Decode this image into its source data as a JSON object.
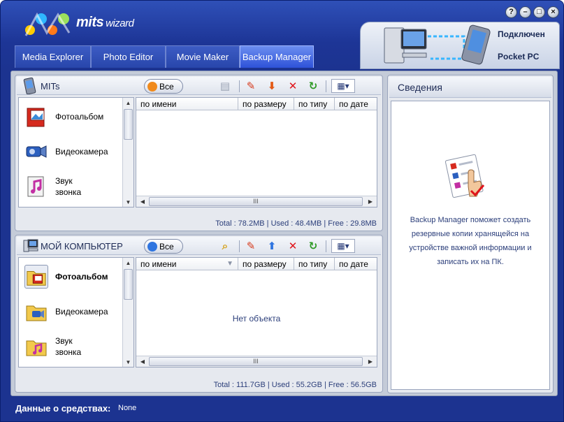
{
  "app": {
    "logo": {
      "brand": "mits",
      "product": "wizard"
    },
    "window_buttons": [
      "?",
      "–",
      "□",
      "×"
    ]
  },
  "tabs": [
    {
      "label": "Media Explorer",
      "active": false
    },
    {
      "label": "Photo Editor",
      "active": false
    },
    {
      "label": "Movie Maker",
      "active": false
    },
    {
      "label": "Backup Manager",
      "active": true
    }
  ],
  "device": {
    "status": "Подключен",
    "name": "Pocket PC"
  },
  "mits_panel": {
    "title": "MITs",
    "all_button": "Все",
    "categories": [
      {
        "label_line1": "Фотоальбом",
        "label_line2": "",
        "icon": "photo-album-icon",
        "selected": false
      },
      {
        "label_line1": "Видеокамера",
        "label_line2": "",
        "icon": "video-camera-icon",
        "selected": false
      },
      {
        "label_line1": "Звук",
        "label_line2": "звонка",
        "icon": "ringtone-icon",
        "selected": false
      }
    ],
    "columns": [
      "по имени",
      "по размеру",
      "по типу",
      "по дате"
    ],
    "empty_message": "",
    "stats": "Total : 78.2MB  |  Used : 48.4MB  |  Free : 29.8MB"
  },
  "pc_panel": {
    "title": "МОЙ КОМПЬЮТЕР",
    "all_button": "Все",
    "categories": [
      {
        "label_line1": "Фотоальбом",
        "label_line2": "",
        "icon": "photo-album-folder-icon",
        "selected": true
      },
      {
        "label_line1": "Видеокамера",
        "label_line2": "",
        "icon": "video-camera-folder-icon",
        "selected": false
      },
      {
        "label_line1": "Звук",
        "label_line2": "звонка",
        "icon": "ringtone-folder-icon",
        "selected": false
      }
    ],
    "columns": [
      "по имени",
      "по размеру",
      "по типу",
      "по дате"
    ],
    "empty_message": "Нет объекта",
    "stats": "Total : 111.7GB  |  Used : 55.2GB  |  Free : 56.5GB"
  },
  "scroll_thumb_label": "III",
  "info": {
    "title": "Сведения",
    "text": "Backup Manager поможет создать резервные копии хранящейся на устройстве важной информации и записать их на ПК."
  },
  "status_bar": {
    "label": "Данные о средствах:",
    "value": "None"
  },
  "colors": {
    "accent": "#2e52d8",
    "frame": "#1c3390",
    "text_blue": "#2b3e7a"
  }
}
